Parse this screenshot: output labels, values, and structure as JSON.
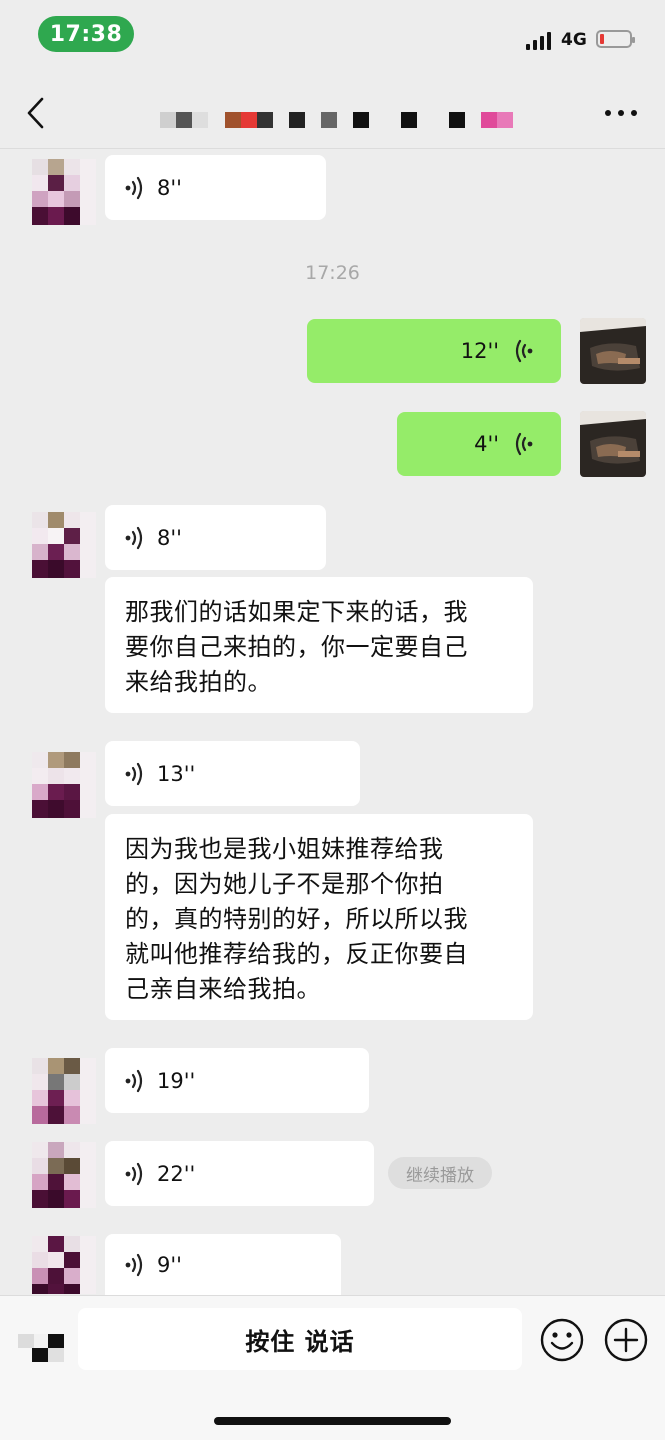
{
  "status_bar": {
    "time": "17:38",
    "network": "4G"
  },
  "header": {
    "back_icon": "chevron-left-icon",
    "more_icon": "more-dots-icon"
  },
  "messages": [
    {
      "side": "left",
      "type": "voice",
      "duration": "8''"
    },
    {
      "side": "center",
      "type": "timestamp",
      "text": "17:26"
    },
    {
      "side": "right",
      "type": "voice",
      "duration": "12''"
    },
    {
      "side": "right",
      "type": "voice",
      "duration": "4''"
    },
    {
      "side": "left",
      "type": "voice",
      "duration": "8''"
    },
    {
      "side": "left",
      "type": "text",
      "lines": [
        "那我们的话如果定下来的话，我",
        "要你自己来拍的，你一定要自己",
        "来给我拍的。"
      ]
    },
    {
      "side": "left",
      "type": "voice",
      "duration": "13''"
    },
    {
      "side": "left",
      "type": "text",
      "lines": [
        "因为我也是我小姐妹推荐给我",
        "的，因为她儿子不是那个你拍",
        "的，真的特别的好，所以所以我",
        "就叫他推荐给我的，反正你要自",
        "己亲自来给我拍。"
      ]
    },
    {
      "side": "left",
      "type": "voice",
      "duration": "19''"
    },
    {
      "side": "left",
      "type": "voice",
      "duration": "22''",
      "action": "继续播放"
    },
    {
      "side": "left",
      "type": "voice",
      "duration": "9''"
    }
  ],
  "input_bar": {
    "hold_to_talk_label": "按住 说话"
  },
  "colors": {
    "self_bubble": "#95ec69",
    "time_pill": "#2fa84f",
    "battery_low": "#e53935"
  }
}
